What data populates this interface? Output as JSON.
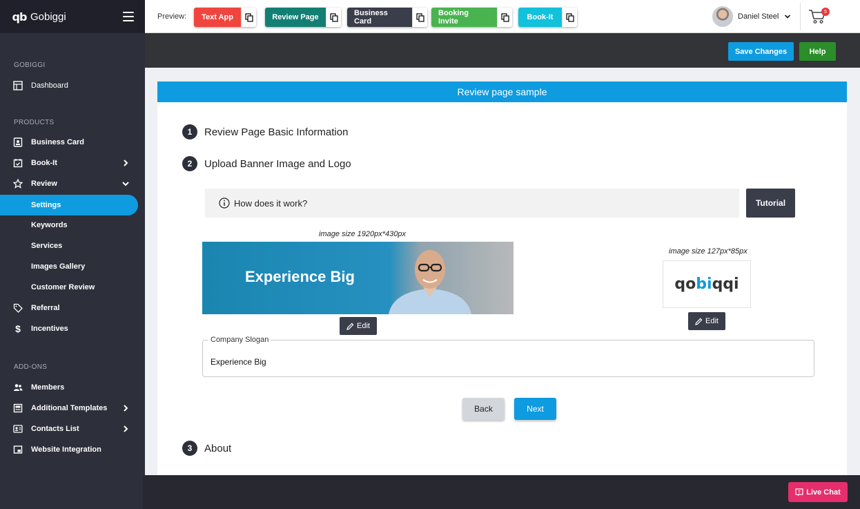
{
  "sidebar": {
    "brand": "Gobiggi",
    "brand_logo": "qb",
    "sections": {
      "gobiggi": "GOBIGGI",
      "products": "PRODUCTS",
      "addons": "ADD-ONS"
    },
    "items": {
      "dashboard": "Dashboard",
      "business_card": "Business Card",
      "book_it": "Book-It",
      "review": "Review",
      "settings": "Settings",
      "keywords": "Keywords",
      "services": "Services",
      "images_gallery": "Images Gallery",
      "customer_review": "Customer Review",
      "referral": "Referral",
      "incentives": "Incentives",
      "members": "Members",
      "additional_templates": "Additional Templates",
      "contacts_list": "Contacts List",
      "website_integration": "Website Integration"
    }
  },
  "topbar": {
    "preview_label": "Preview:",
    "previews": [
      {
        "label": "Text App",
        "color": "#f0453f"
      },
      {
        "label": "Review Page",
        "color": "#137f74"
      },
      {
        "label": "Business Card",
        "color": "#3a3d4a"
      },
      {
        "label": "Booking Invite",
        "color": "#49b34f"
      },
      {
        "label": "Book-It",
        "color": "#12c1db"
      }
    ],
    "user_name": "Daniel Steel",
    "cart_count": "5"
  },
  "actions": {
    "save": "Save Changes",
    "help": "Help"
  },
  "main": {
    "header": "Review page sample",
    "steps": [
      {
        "num": "1",
        "title": "Review Page Basic Information"
      },
      {
        "num": "2",
        "title": "Upload Banner Image and Logo"
      },
      {
        "num": "3",
        "title": "About"
      }
    ],
    "how_it_works": "How does it work?",
    "tutorial": "Tutorial",
    "banner_size": "image size 1920px*430px",
    "banner_text": "Experience Big",
    "logo_size": "image size 127px*85px",
    "logo_text_a": "qo",
    "logo_text_b": "bi",
    "logo_text_c": "qqi",
    "edit": "Edit",
    "slogan_label": "Company Slogan",
    "slogan_value": "Experience Big",
    "back": "Back",
    "next": "Next"
  },
  "live_chat": "Live Chat",
  "colors": {
    "accent": "#0f9bdf",
    "sidebar": "#2d2f3a",
    "help": "#2b8e2b",
    "live_chat": "#e52e6b"
  }
}
